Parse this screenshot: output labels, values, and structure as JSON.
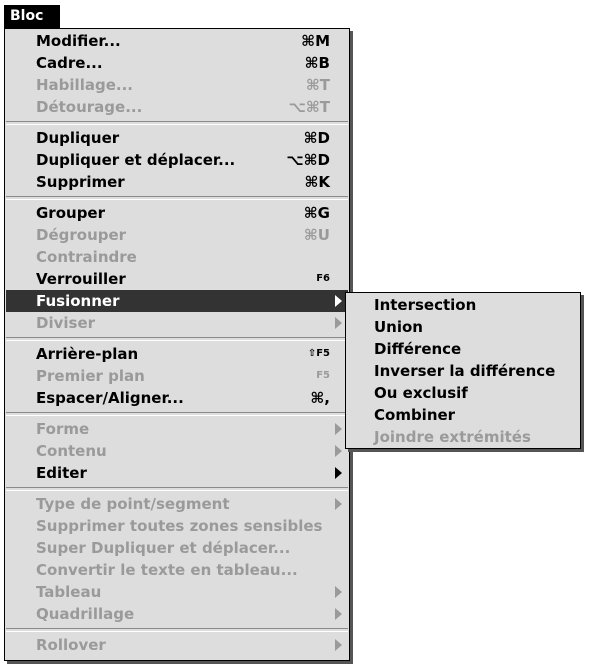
{
  "menu_title": "Bloc",
  "items": [
    {
      "label": "Modifier...",
      "shortcut": "⌘M",
      "disabled": false
    },
    {
      "label": "Cadre...",
      "shortcut": "⌘B",
      "disabled": false
    },
    {
      "label": "Habillage...",
      "shortcut": "⌘T",
      "disabled": true
    },
    {
      "label": "Détourage...",
      "shortcut": "⌥⌘T",
      "disabled": true
    },
    {
      "label": "Dupliquer",
      "shortcut": "⌘D",
      "disabled": false
    },
    {
      "label": "Dupliquer et déplacer...",
      "shortcut": "⌥⌘D",
      "disabled": false
    },
    {
      "label": "Supprimer",
      "shortcut": "⌘K",
      "disabled": false
    },
    {
      "label": "Grouper",
      "shortcut": "⌘G",
      "disabled": false
    },
    {
      "label": "Dégrouper",
      "shortcut": "⌘U",
      "disabled": true
    },
    {
      "label": "Contraindre",
      "shortcut": "",
      "disabled": true
    },
    {
      "label": "Verrouiller",
      "shortcut": "F6",
      "disabled": false
    },
    {
      "label": "Fusionner",
      "shortcut": "",
      "disabled": false,
      "submenu": true,
      "selected": true
    },
    {
      "label": "Diviser",
      "shortcut": "",
      "disabled": true,
      "submenu": true
    },
    {
      "label": "Arrière-plan",
      "shortcut": "⇧F5",
      "disabled": false
    },
    {
      "label": "Premier plan",
      "shortcut": "F5",
      "disabled": true
    },
    {
      "label": "Espacer/Aligner...",
      "shortcut": "⌘,",
      "disabled": false
    },
    {
      "label": "Forme",
      "shortcut": "",
      "disabled": true,
      "submenu": true
    },
    {
      "label": "Contenu",
      "shortcut": "",
      "disabled": true,
      "submenu": true
    },
    {
      "label": "Editer",
      "shortcut": "",
      "disabled": false,
      "submenu": true
    },
    {
      "label": "Type de point/segment",
      "shortcut": "",
      "disabled": true,
      "submenu": true
    },
    {
      "label": "Supprimer toutes zones sensibles",
      "shortcut": "",
      "disabled": true
    },
    {
      "label": "Super Dupliquer et déplacer...",
      "shortcut": "",
      "disabled": true
    },
    {
      "label": "Convertir le texte en tableau...",
      "shortcut": "",
      "disabled": true
    },
    {
      "label": "Tableau",
      "shortcut": "",
      "disabled": true,
      "submenu": true
    },
    {
      "label": "Quadrillage",
      "shortcut": "",
      "disabled": true,
      "submenu": true
    },
    {
      "label": "Rollover",
      "shortcut": "",
      "disabled": true,
      "submenu": true
    }
  ],
  "submenu": [
    {
      "label": "Intersection",
      "disabled": false
    },
    {
      "label": "Union",
      "disabled": false
    },
    {
      "label": "Différence",
      "disabled": false
    },
    {
      "label": "Inverser la différence",
      "disabled": false
    },
    {
      "label": "Ou exclusif",
      "disabled": false
    },
    {
      "label": "Combiner",
      "disabled": false
    },
    {
      "label": "Joindre extrémités",
      "disabled": true
    }
  ]
}
